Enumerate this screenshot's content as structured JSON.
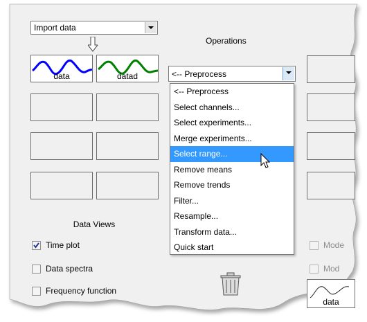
{
  "import_dropdown": {
    "value": "Import data"
  },
  "operations": {
    "heading": "Operations",
    "selected": "<-- Preprocess",
    "items": [
      "<-- Preprocess",
      "Select channels...",
      "Select experiments...",
      "Merge experiments...",
      "Select range...",
      "Remove means",
      "Remove trends",
      "Filter...",
      "Resample...",
      "Transform data...",
      "Quick start"
    ],
    "highlighted_index": 4
  },
  "data_board": {
    "tiles": [
      {
        "label": "data",
        "color": "#0000ff"
      },
      {
        "label": "datad",
        "color": "#008000"
      }
    ]
  },
  "data_views": {
    "heading": "Data Views",
    "checkboxes": [
      {
        "label": "Time plot",
        "checked": true
      },
      {
        "label": "Data spectra",
        "checked": false
      },
      {
        "label": "Frequency function",
        "checked": false
      }
    ]
  },
  "model_views": {
    "checkboxes": [
      {
        "label": "Mode",
        "checked": false
      },
      {
        "label": "Mod",
        "checked": false
      }
    ],
    "tile": {
      "label": "data"
    }
  },
  "colors": {
    "selection": "#3399ff",
    "tile_border": "#6b6b6b",
    "panel_bg": "#f0f0f0"
  }
}
